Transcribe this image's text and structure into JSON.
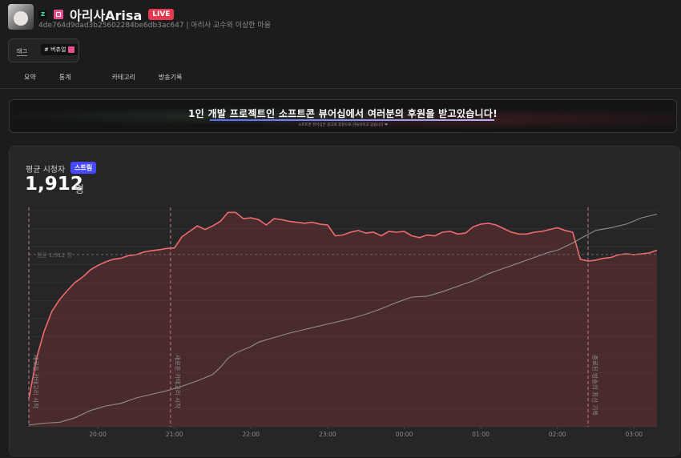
{
  "channel": {
    "name": "아리사Arisa",
    "live_label": "LIVE",
    "id_line": "4de764d9dad3b25602284be6db3ac647 | 아리사 교수와 이상한 마을",
    "platform_mark": "z"
  },
  "tags": {
    "label": "태그",
    "chip": "# 버츄얼"
  },
  "tabs": [
    "요약",
    "통계",
    "카테고리",
    "방송기록"
  ],
  "banner": {
    "title": "1인 개발 프로젝트인 소프트콘 뷰어십에서 여러분의 후원을 받고있습니다!",
    "subtitle": "소프트콘 뷰어십은 광고와 후원으로 만들어지고 있습니다 ❤"
  },
  "stat": {
    "label": "평균 시청자",
    "badge": "스트림",
    "value": "1,912",
    "unit": "명"
  },
  "chart_data": {
    "type": "line",
    "x_ticks": [
      "20:00",
      "21:00",
      "22:00",
      "23:00",
      "00:00",
      "01:00",
      "02:00",
      "03:00"
    ],
    "x_range_hours": [
      19.1,
      27.3
    ],
    "y_range": [
      0,
      2400
    ],
    "average_label": "평균 1,912 명",
    "average_value": 1912,
    "series": [
      {
        "color": "#ee6b6b",
        "fill": true,
        "points": [
          [
            19.1,
            310
          ],
          [
            19.2,
            760
          ],
          [
            19.3,
            1060
          ],
          [
            19.4,
            1280
          ],
          [
            19.5,
            1410
          ],
          [
            19.6,
            1510
          ],
          [
            19.7,
            1600
          ],
          [
            19.8,
            1660
          ],
          [
            19.9,
            1740
          ],
          [
            20.0,
            1790
          ],
          [
            20.1,
            1830
          ],
          [
            20.2,
            1860
          ],
          [
            20.3,
            1870
          ],
          [
            20.4,
            1900
          ],
          [
            20.5,
            1910
          ],
          [
            20.6,
            1940
          ],
          [
            20.7,
            1955
          ],
          [
            20.8,
            1965
          ],
          [
            20.9,
            1980
          ],
          [
            21.0,
            1985
          ],
          [
            21.1,
            2110
          ],
          [
            21.2,
            2170
          ],
          [
            21.3,
            2230
          ],
          [
            21.4,
            2190
          ],
          [
            21.5,
            2230
          ],
          [
            21.6,
            2280
          ],
          [
            21.7,
            2380
          ],
          [
            21.8,
            2380
          ],
          [
            21.9,
            2310
          ],
          [
            22.0,
            2320
          ],
          [
            22.1,
            2300
          ],
          [
            22.2,
            2240
          ],
          [
            22.3,
            2310
          ],
          [
            22.4,
            2300
          ],
          [
            22.5,
            2280
          ],
          [
            22.6,
            2270
          ],
          [
            22.7,
            2260
          ],
          [
            22.8,
            2270
          ],
          [
            22.9,
            2250
          ],
          [
            23.0,
            2240
          ],
          [
            23.1,
            2120
          ],
          [
            23.2,
            2130
          ],
          [
            23.3,
            2160
          ],
          [
            23.4,
            2180
          ],
          [
            23.5,
            2150
          ],
          [
            23.6,
            2160
          ],
          [
            23.7,
            2120
          ],
          [
            23.8,
            2170
          ],
          [
            23.9,
            2160
          ],
          [
            24.0,
            2170
          ],
          [
            24.1,
            2120
          ],
          [
            24.2,
            2100
          ],
          [
            24.3,
            2130
          ],
          [
            24.4,
            2120
          ],
          [
            24.5,
            2160
          ],
          [
            24.6,
            2170
          ],
          [
            24.7,
            2140
          ],
          [
            24.8,
            2150
          ],
          [
            24.9,
            2220
          ],
          [
            25.0,
            2250
          ],
          [
            25.1,
            2260
          ],
          [
            25.2,
            2240
          ],
          [
            25.3,
            2200
          ],
          [
            25.4,
            2160
          ],
          [
            25.5,
            2140
          ],
          [
            25.6,
            2140
          ],
          [
            25.7,
            2160
          ],
          [
            25.8,
            2170
          ],
          [
            25.9,
            2190
          ],
          [
            26.0,
            2210
          ],
          [
            26.1,
            2180
          ],
          [
            26.2,
            2160
          ],
          [
            26.3,
            1860
          ],
          [
            26.4,
            1840
          ],
          [
            26.5,
            1850
          ],
          [
            26.6,
            1870
          ],
          [
            26.7,
            1880
          ],
          [
            26.8,
            1910
          ],
          [
            26.9,
            1920
          ],
          [
            27.0,
            1910
          ],
          [
            27.1,
            1920
          ],
          [
            27.2,
            1930
          ],
          [
            27.3,
            1960
          ]
        ]
      },
      {
        "color": "#8e8e8e",
        "fill": false,
        "points": [
          [
            19.1,
            20
          ],
          [
            19.3,
            40
          ],
          [
            19.5,
            50
          ],
          [
            19.7,
            100
          ],
          [
            19.9,
            180
          ],
          [
            20.1,
            230
          ],
          [
            20.3,
            260
          ],
          [
            20.5,
            320
          ],
          [
            20.7,
            360
          ],
          [
            20.9,
            400
          ],
          [
            21.1,
            450
          ],
          [
            21.3,
            510
          ],
          [
            21.5,
            580
          ],
          [
            21.6,
            660
          ],
          [
            21.7,
            760
          ],
          [
            21.8,
            820
          ],
          [
            22.0,
            890
          ],
          [
            22.1,
            940
          ],
          [
            22.3,
            990
          ],
          [
            22.5,
            1040
          ],
          [
            22.7,
            1080
          ],
          [
            22.9,
            1120
          ],
          [
            23.1,
            1160
          ],
          [
            23.3,
            1200
          ],
          [
            23.5,
            1250
          ],
          [
            23.7,
            1310
          ],
          [
            23.9,
            1380
          ],
          [
            24.1,
            1440
          ],
          [
            24.3,
            1450
          ],
          [
            24.5,
            1500
          ],
          [
            24.7,
            1560
          ],
          [
            24.9,
            1620
          ],
          [
            25.1,
            1700
          ],
          [
            25.3,
            1760
          ],
          [
            25.5,
            1820
          ],
          [
            25.7,
            1880
          ],
          [
            25.9,
            1940
          ],
          [
            26.0,
            1960
          ],
          [
            26.1,
            2000
          ],
          [
            26.2,
            2040
          ],
          [
            26.3,
            2090
          ],
          [
            26.5,
            2180
          ],
          [
            26.7,
            2210
          ],
          [
            26.9,
            2250
          ],
          [
            27.1,
            2320
          ],
          [
            27.3,
            2360
          ]
        ]
      }
    ],
    "markers": [
      {
        "x": 19.1,
        "label": "새로운 카테고리 시작"
      },
      {
        "x": 20.95,
        "label": "새로운 카테고리 시작"
      },
      {
        "x": 26.4,
        "label": "종료된 방송의 최신 기록"
      }
    ]
  }
}
